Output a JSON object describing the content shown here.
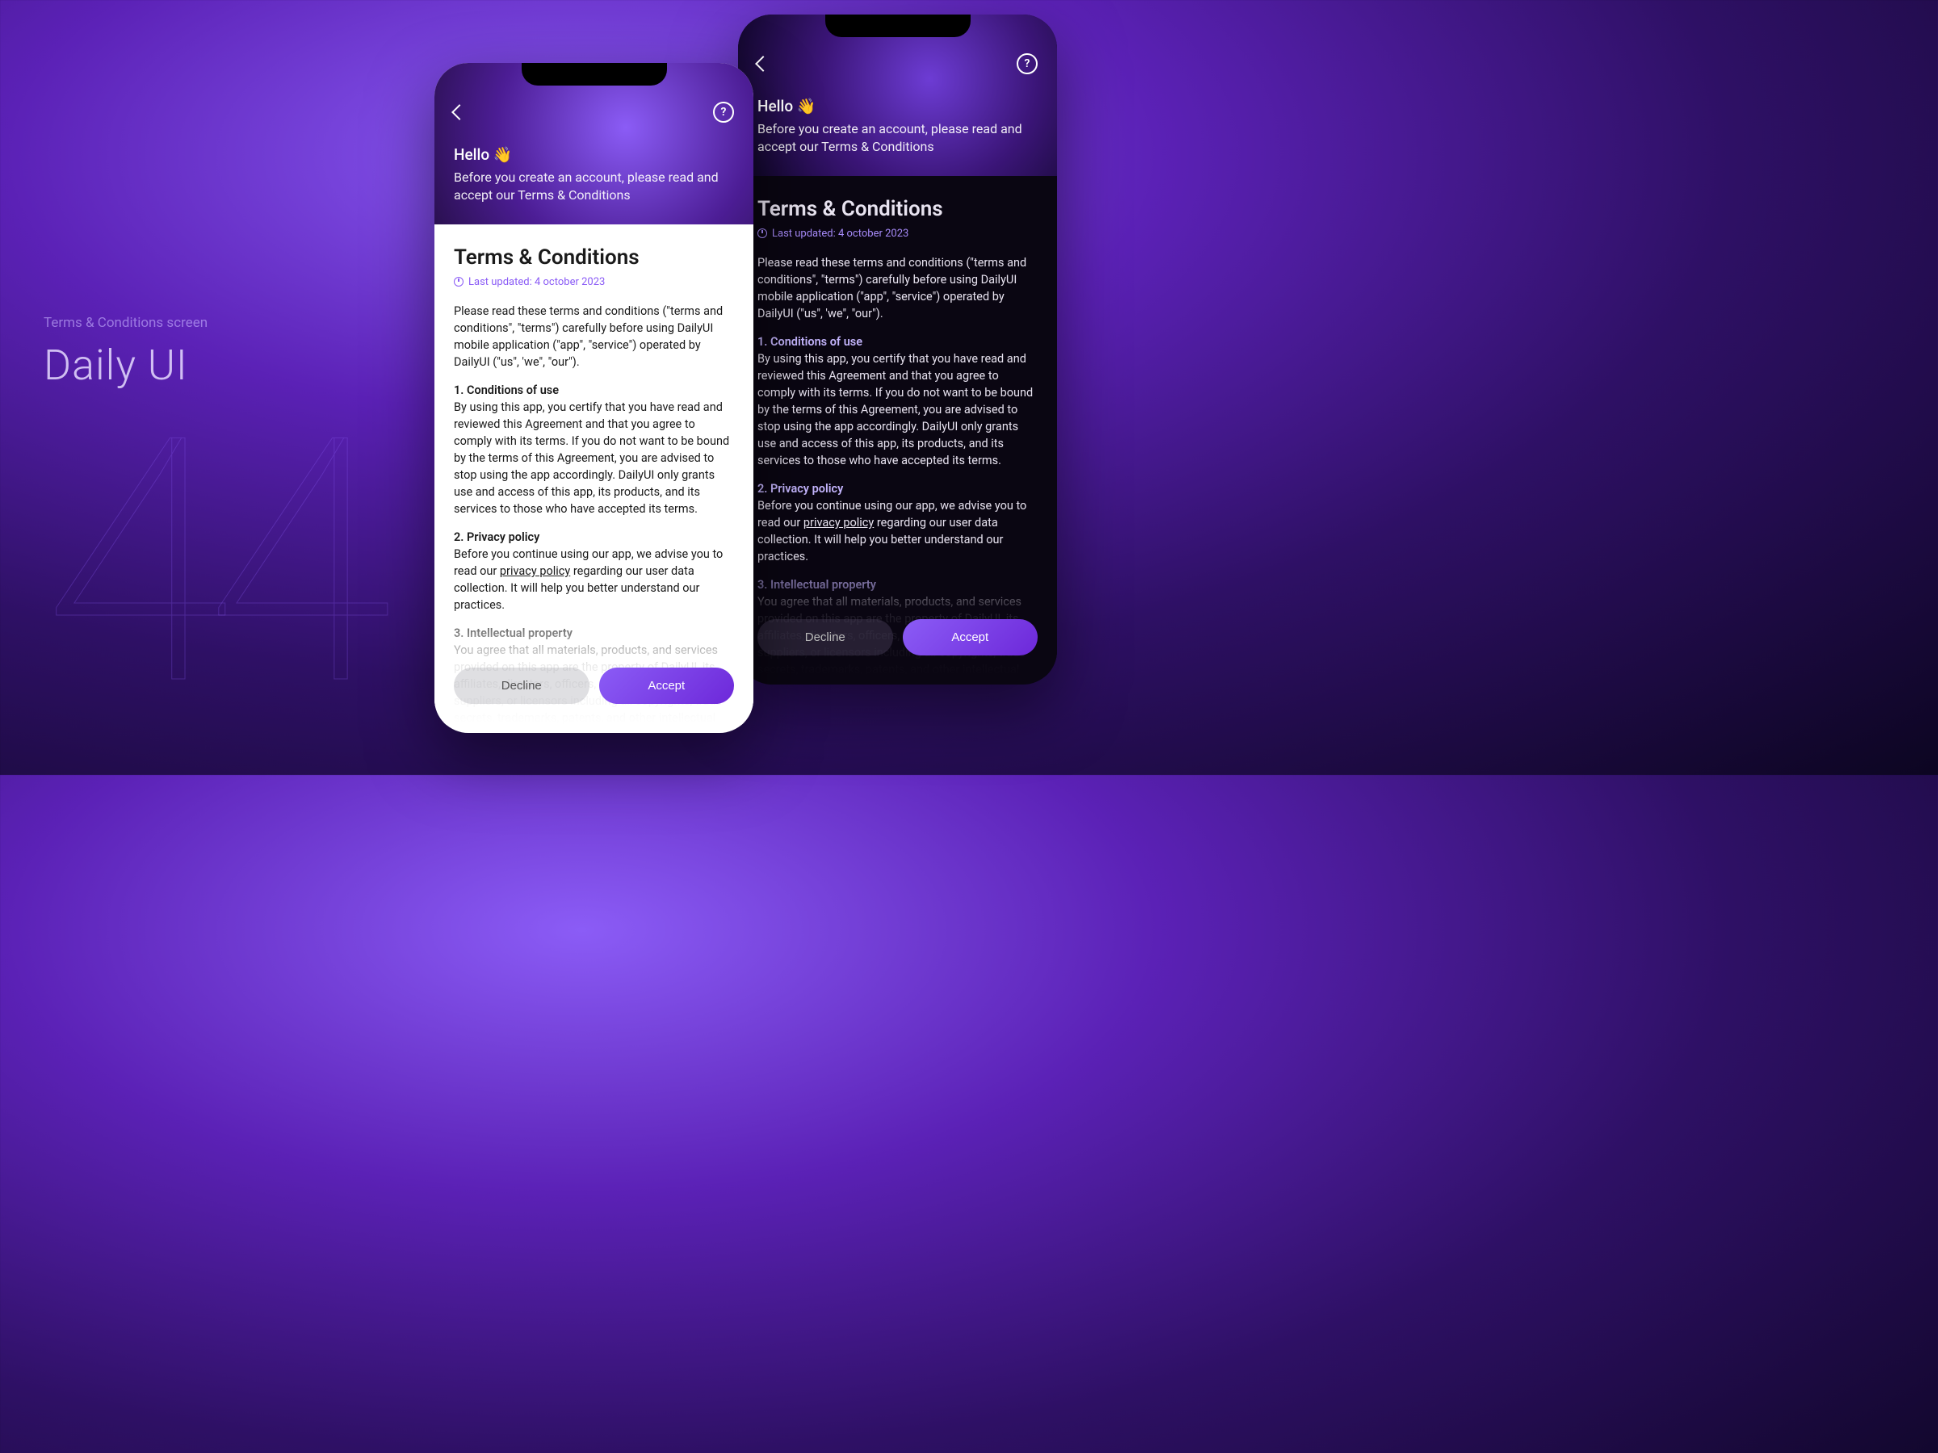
{
  "left": {
    "label": "Terms & Conditions screen",
    "title": "Daily UI",
    "number": "44"
  },
  "header": {
    "greeting": "Hello 👋",
    "subtitle": "Before you create an account, please read and accept our Terms & Conditions",
    "help": "?"
  },
  "doc": {
    "title": "Terms & Conditions",
    "updated": "Last updated: 4 october 2023",
    "intro": "Please read these terms and conditions (\"terms and conditions\", \"terms\") carefully before using DailyUI mobile application (\"app\", \"service\") operated by DailyUI (\"us\", 'we\", \"our\").",
    "s1_head": "1. Conditions of use",
    "s1_body": "By using this app, you certify that you have read and reviewed this Agreement and that you agree to comply with its terms. If you do not want to be bound by the terms of this Agreement, you are advised to stop using the app accordingly. DailyUI only grants use and access of this app, its products, and its services to those who have accepted its terms.",
    "s2_head": "2. Privacy policy",
    "s2_body_a": "Before you continue using our app, we advise you to read our ",
    "s2_link": "privacy policy",
    "s2_body_b": " regarding our user data collection. It will help you better understand our practices.",
    "s3_head": "3. Intellectual property",
    "s3_body": "You agree that all materials, products, and services provided on this app are the property of DailyUI, its affiliates, directors, officers, employees, agents, suppliers, or licensors including all copyrights, trade secrets, trademarks, patents, and other intellectual property. You also agree that you will not reproduce or redistribute the DailyUI's intellectual"
  },
  "buttons": {
    "decline": "Decline",
    "accept": "Accept"
  }
}
